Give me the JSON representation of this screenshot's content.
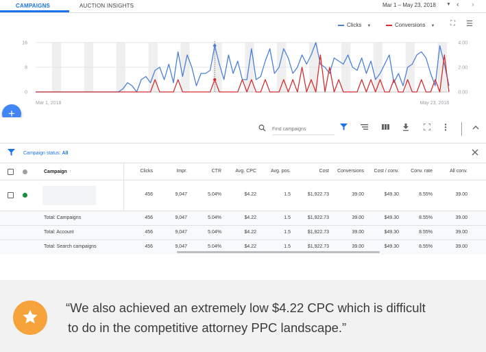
{
  "tabs": {
    "campaigns": "CAMPAIGNS",
    "auction_insights": "AUCTION INSIGHTS"
  },
  "date_range": "Mar 1 – May 23, 2018",
  "chart_legend": {
    "clicks": "Clicks",
    "conversions": "Conversions"
  },
  "colors": {
    "accent": "#1a73e8",
    "clicks_line": "#4a7fd6",
    "conversions_line": "#d32f2f",
    "star_badge": "#f5a33a",
    "active_status": "#1e8e3e"
  },
  "icons": {
    "fab": "plus-icon",
    "search": "search-icon",
    "filter": "filter-icon",
    "segment": "segment-icon",
    "columns": "columns-icon",
    "download": "download-icon",
    "expand": "expand-icon",
    "more": "more-vert-icon",
    "collapse": "chevron-up-icon",
    "close": "close-icon",
    "star": "star-icon"
  },
  "chart_data": {
    "type": "line",
    "x_start_label": "Mar 1, 2018",
    "x_end_label": "May 23, 2018",
    "left_axis": {
      "ticks": [
        "16",
        "8",
        "0"
      ],
      "range": [
        0,
        16
      ]
    },
    "right_axis": {
      "ticks": [
        "4.00",
        "2.00",
        "0.00"
      ],
      "range": [
        0,
        4
      ]
    },
    "grid": true,
    "legend_position": "top-right",
    "series": [
      {
        "name": "Clicks",
        "axis": "left",
        "values": [
          0,
          0,
          0,
          0,
          0,
          0,
          0,
          0,
          0,
          0,
          0,
          0,
          0,
          0,
          0,
          0,
          0,
          0,
          0,
          1,
          3,
          2,
          0,
          4,
          5,
          3,
          7,
          8,
          4,
          9,
          3,
          13,
          5,
          12,
          8,
          2,
          6,
          6,
          7,
          15,
          9,
          4,
          12,
          6,
          10,
          4,
          4,
          14,
          4,
          5,
          10,
          14,
          6,
          8,
          14,
          11,
          6,
          8,
          12,
          9,
          12,
          16,
          9,
          8,
          6,
          11,
          10,
          9,
          12,
          8,
          7,
          11,
          6,
          10,
          4,
          6,
          9,
          12,
          3,
          6,
          2,
          8,
          9,
          12,
          13,
          11,
          6,
          2,
          15,
          9,
          2
        ]
      },
      {
        "name": "Conversions",
        "axis": "right",
        "values": [
          0,
          0,
          0,
          0,
          0,
          0,
          0,
          0,
          0,
          0,
          0,
          0,
          0,
          0,
          0,
          0,
          0,
          0,
          0,
          0,
          0,
          0,
          0,
          0,
          0,
          0,
          1,
          0,
          0,
          0,
          0,
          1,
          0,
          0,
          0,
          0,
          0,
          0,
          0,
          1,
          0,
          0,
          0,
          0,
          0,
          1,
          0,
          1,
          0,
          0,
          1,
          0,
          0,
          0,
          1,
          0,
          1,
          0,
          2,
          0,
          1,
          0,
          3,
          0,
          2,
          0,
          1,
          0,
          0,
          0,
          0,
          1,
          0,
          1,
          0,
          1,
          0,
          0,
          1,
          0,
          0,
          1,
          0,
          0,
          1,
          0,
          0,
          1,
          0,
          3,
          0
        ]
      }
    ]
  },
  "toolbar": {
    "search_placeholder": "Find campaigns"
  },
  "filter": {
    "label": "Campaign status:",
    "value": "All"
  },
  "table": {
    "headers": {
      "campaign": "Campaign",
      "sort": "↑",
      "clicks": "Clicks",
      "impr": "Impr.",
      "ctr": "CTR",
      "avg_cpc": "Avg. CPC",
      "avg_pos": "Avg. pos.",
      "cost": "Cost",
      "conversions": "Conversions",
      "cost_conv": "Cost / conv.",
      "conv_rate": "Conv. rate",
      "all_conv": "All conv."
    },
    "campaign_row": {
      "clicks": "456",
      "impr": "9,047",
      "ctr": "5.04%",
      "avg_cpc": "$4.22",
      "avg_pos": "1.5",
      "cost": "$1,922.73",
      "conversions": "39.00",
      "cost_conv": "$49.30",
      "conv_rate": "8.55%",
      "all_conv": "39.00"
    },
    "totals": [
      {
        "label": "Total: Campaigns",
        "clicks": "456",
        "impr": "9,047",
        "ctr": "5.04%",
        "avg_cpc": "$4.22",
        "avg_pos": "1.5",
        "cost": "$1,922.73",
        "conversions": "39.00",
        "cost_conv": "$49.30",
        "conv_rate": "8.55%",
        "all_conv": "39.00"
      },
      {
        "label": "Total: Account",
        "clicks": "456",
        "impr": "9,047",
        "ctr": "5.04%",
        "avg_cpc": "$4.22",
        "avg_pos": "1.5",
        "cost": "$1,922.73",
        "conversions": "39.00",
        "cost_conv": "$49.30",
        "conv_rate": "8.55%",
        "all_conv": "39.00"
      },
      {
        "label": "Total: Search campaigns",
        "clicks": "456",
        "impr": "9,047",
        "ctr": "5.04%",
        "avg_cpc": "$4.22",
        "avg_pos": "1.5",
        "cost": "$1,922.73",
        "conversions": "39.00",
        "cost_conv": "$49.30",
        "conv_rate": "8.55%",
        "all_conv": "39.00"
      }
    ]
  },
  "testimonial": {
    "line1": "“We also achieved an extremely low $4.22 CPC which is difficult",
    "line2": "to do in the competitive attorney PPC landscape.”"
  }
}
